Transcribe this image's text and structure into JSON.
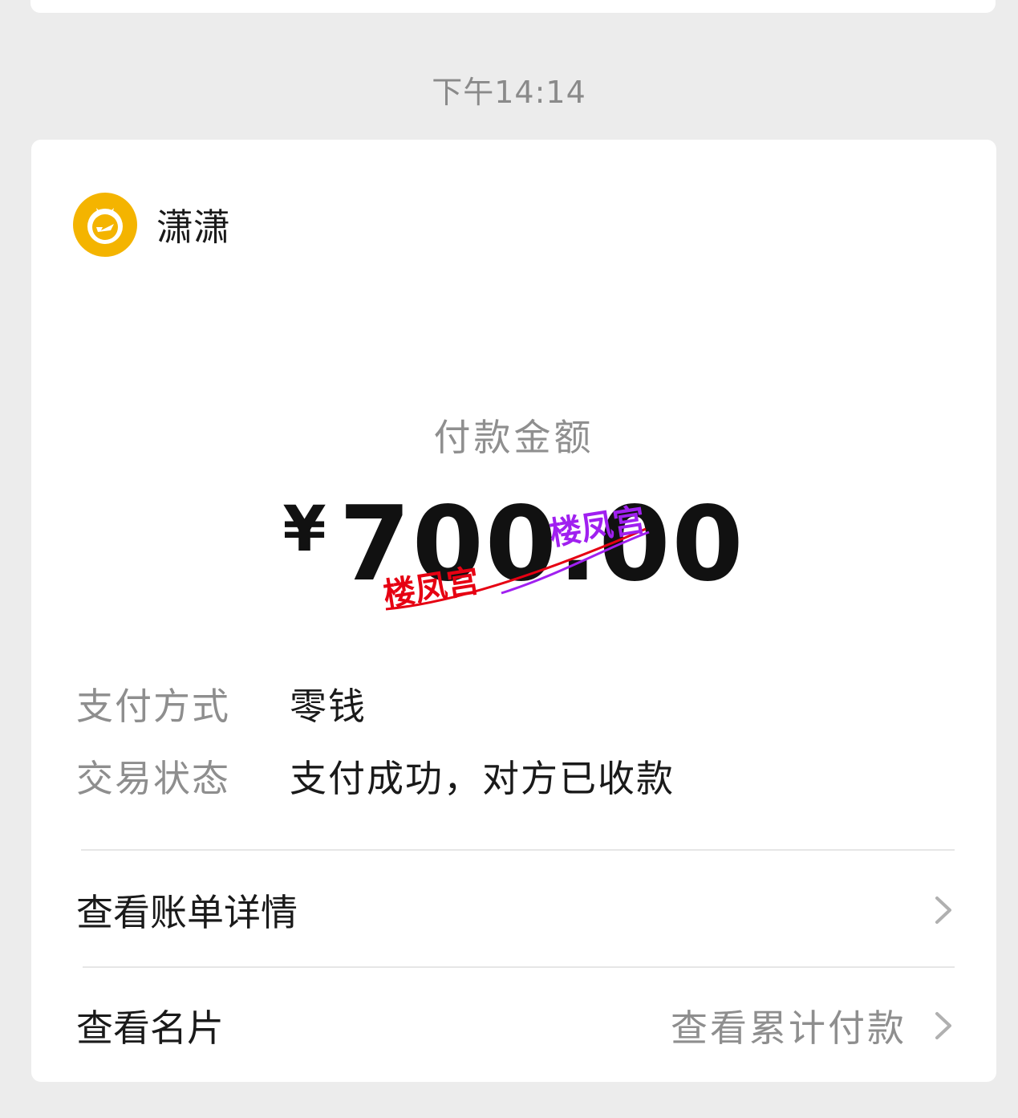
{
  "timestamp": "下午14:14",
  "merchant": {
    "name": "潇潇",
    "icon": "merchant-bag-icon"
  },
  "payment": {
    "amount_label": "付款金额",
    "currency_symbol": "¥",
    "amount": "700.00"
  },
  "details": [
    {
      "label": "支付方式",
      "value": "零钱"
    },
    {
      "label": "交易状态",
      "value": "支付成功，对方已收款"
    }
  ],
  "links": {
    "bill_details": "查看账单详情",
    "business_card": "查看名片",
    "cumulative_payment": "查看累计付款"
  },
  "watermarks": [
    "楼凤宫",
    "楼凤宫"
  ],
  "colors": {
    "background": "#ececec",
    "card": "#ffffff",
    "merchant_icon": "#f4b400",
    "label_gray": "#8e8e8e",
    "watermark_red": "#e60012",
    "watermark_purple": "#a020f0"
  }
}
